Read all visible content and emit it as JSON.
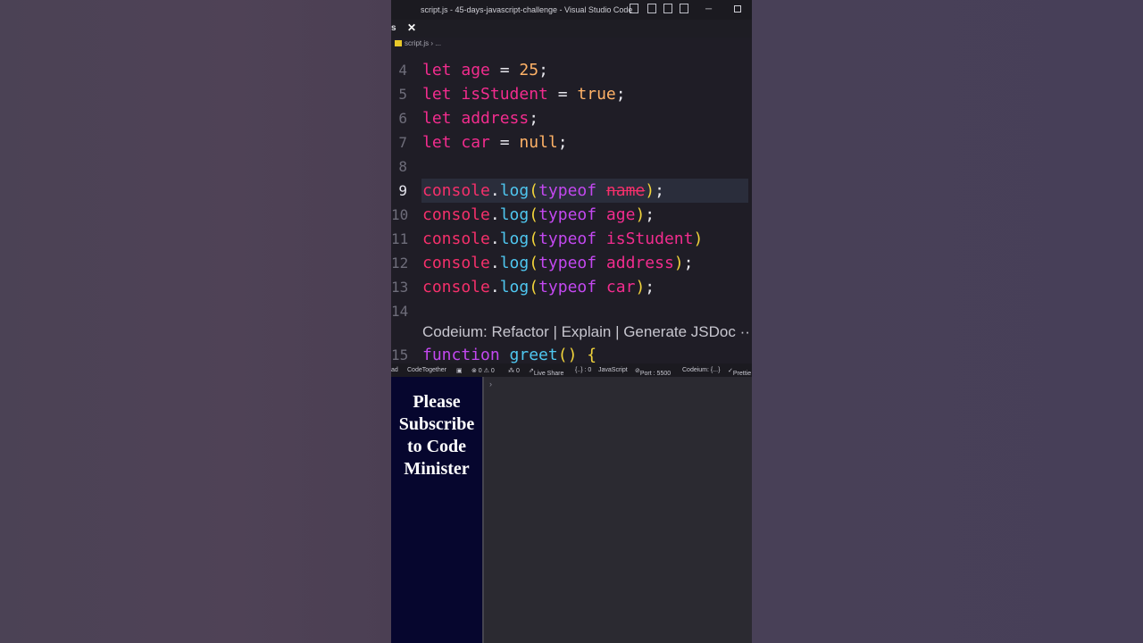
{
  "window": {
    "title": "script.js - 45-days-javascript-challenge - Visual Studio Code",
    "minimize_glyph": "─"
  },
  "tabs": {
    "partial_tab_label": "s",
    "close_glyph": "✕"
  },
  "breadcrumb": {
    "file": "script.js",
    "separator": "›",
    "more": "..."
  },
  "editor": {
    "lines": [
      {
        "number": "4",
        "tokens": [
          [
            "kw",
            "let "
          ],
          [
            "var",
            "age"
          ],
          [
            "op",
            " = "
          ],
          [
            "num",
            "25"
          ],
          [
            "op",
            ";"
          ]
        ]
      },
      {
        "number": "5",
        "tokens": [
          [
            "kw",
            "let "
          ],
          [
            "var",
            "isStudent"
          ],
          [
            "op",
            " = "
          ],
          [
            "bool",
            "true"
          ],
          [
            "op",
            ";"
          ]
        ]
      },
      {
        "number": "6",
        "tokens": [
          [
            "kw",
            "let "
          ],
          [
            "var",
            "address"
          ],
          [
            "op",
            ";"
          ]
        ]
      },
      {
        "number": "7",
        "tokens": [
          [
            "kw",
            "let "
          ],
          [
            "var",
            "car"
          ],
          [
            "op",
            " = "
          ],
          [
            "bool",
            "null"
          ],
          [
            "op",
            ";"
          ]
        ]
      },
      {
        "number": "8",
        "tokens": []
      },
      {
        "number": "9",
        "tokens": [
          [
            "obj",
            "console"
          ],
          [
            "op",
            "."
          ],
          [
            "fn",
            "log"
          ],
          [
            "paren",
            "("
          ],
          [
            "typeof",
            "typeof "
          ],
          [
            "strike",
            "name"
          ],
          [
            "paren",
            ")"
          ],
          [
            "op",
            ";"
          ]
        ]
      },
      {
        "number": "10",
        "tokens": [
          [
            "obj",
            "console"
          ],
          [
            "op",
            "."
          ],
          [
            "fn",
            "log"
          ],
          [
            "paren",
            "("
          ],
          [
            "typeof",
            "typeof "
          ],
          [
            "var",
            "age"
          ],
          [
            "paren",
            ")"
          ],
          [
            "op",
            ";"
          ]
        ]
      },
      {
        "number": "11",
        "tokens": [
          [
            "obj",
            "console"
          ],
          [
            "op",
            "."
          ],
          [
            "fn",
            "log"
          ],
          [
            "paren",
            "("
          ],
          [
            "typeof",
            "typeof "
          ],
          [
            "var",
            "isStudent"
          ],
          [
            "paren",
            ")"
          ]
        ]
      },
      {
        "number": "12",
        "tokens": [
          [
            "obj",
            "console"
          ],
          [
            "op",
            "."
          ],
          [
            "fn",
            "log"
          ],
          [
            "paren",
            "("
          ],
          [
            "typeof",
            "typeof "
          ],
          [
            "var",
            "address"
          ],
          [
            "paren",
            ")"
          ],
          [
            "op",
            ";"
          ]
        ]
      },
      {
        "number": "13",
        "tokens": [
          [
            "obj",
            "console"
          ],
          [
            "op",
            "."
          ],
          [
            "fn",
            "log"
          ],
          [
            "paren",
            "("
          ],
          [
            "typeof",
            "typeof "
          ],
          [
            "var",
            "car"
          ],
          [
            "paren",
            ")"
          ],
          [
            "op",
            ";"
          ]
        ]
      },
      {
        "number": "14",
        "tokens": []
      }
    ],
    "current_line": "9",
    "codeium_lens": "Codeium: Refactor | Explain | Generate JSDoc ··",
    "line15": {
      "number": "15",
      "tokens": [
        [
          "func-kw",
          "function "
        ],
        [
          "func-name",
          "greet"
        ],
        [
          "paren",
          "() {"
        ]
      ]
    }
  },
  "statusbar": {
    "left_partial": "ad",
    "codetogether": "CodeTogether",
    "problems": "⊗ 0 ⚠ 0",
    "broadcast": "⁂ 0",
    "liveshare": "Live Share",
    "braces": "{..} : 0",
    "language": "JavaScript",
    "port": "Port : 5500",
    "codeium": "Codeium: {...}",
    "prettier": "Prettie"
  },
  "overlay": {
    "subscribe_text": "Please Subscribe to Code Minister"
  },
  "terminal": {
    "prompt": "›"
  }
}
